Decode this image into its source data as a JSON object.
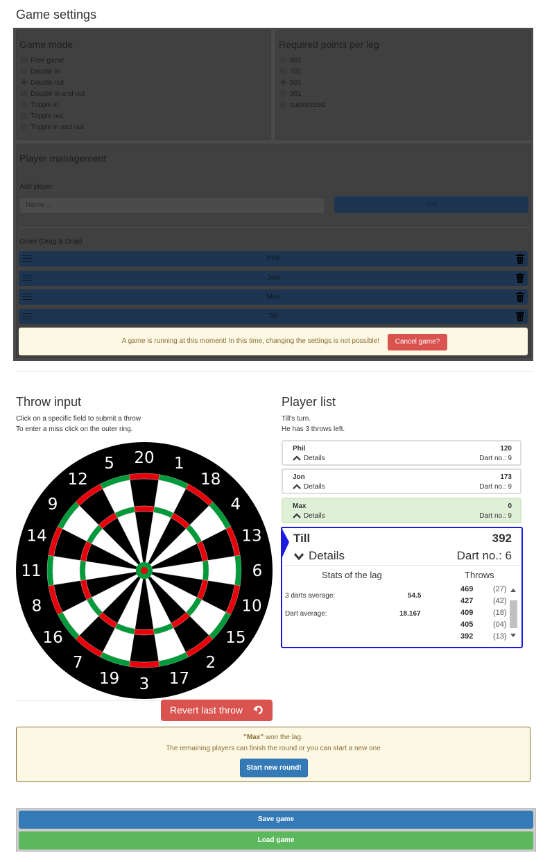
{
  "settings": {
    "title": "Game settings",
    "game_mode": {
      "title": "Game mode",
      "options": [
        "Free game",
        "Double in",
        "Double out",
        "Double in and out",
        "Tripple in",
        "Tripple out",
        "Tripple in and out"
      ],
      "selected_index": 2
    },
    "points": {
      "title": "Required points per leg",
      "options": [
        "901",
        "701",
        "501",
        "301",
        "customized"
      ],
      "selected_index": 2
    },
    "player_management": {
      "title": "Player management",
      "add_label": "Add player",
      "name_placeholder": "Name ...",
      "add_button": "add",
      "order_label": "Order (Drag & Drop)",
      "players": [
        "Phil",
        "Jon",
        "Max",
        "Till"
      ]
    },
    "running_alert": "A game is running at this moment! In this time, changing the settings is not possible!",
    "cancel_button": "Cancel game?"
  },
  "throw_input": {
    "title": "Throw input",
    "hint1": "Click on a specific field to submit a throw",
    "hint2": "To enter a miss click on the outer ring.",
    "board_numbers": [
      "20",
      "1",
      "18",
      "4",
      "13",
      "6",
      "10",
      "15",
      "2",
      "17",
      "3",
      "19",
      "7",
      "16",
      "8",
      "11",
      "14",
      "9",
      "12",
      "5"
    ],
    "revert_button": "Revert last throw"
  },
  "player_list": {
    "title": "Player list",
    "turn_line1": "Till's turn.",
    "turn_line2": "He has 3 throws left.",
    "details_label": "Details",
    "dart_no_prefix": "Dart no.:",
    "players": [
      {
        "name": "Phil",
        "points": "120",
        "dart_no": "Dart no.: 9"
      },
      {
        "name": "Jon",
        "points": "173",
        "dart_no": "Dart no.: 9"
      },
      {
        "name": "Max",
        "points": "0",
        "dart_no": "Dart no.: 9"
      }
    ],
    "active": {
      "name": "Till",
      "points": "392",
      "details": "Details",
      "dart_no": "Dart no.: 6",
      "stats_title": "Stats of the lag",
      "throws_title": "Throws",
      "three_dart_label": "3 darts average:",
      "three_dart_value": "54.5",
      "dart_avg_label": "Dart average:",
      "dart_avg_value": "18.167",
      "throws": [
        {
          "score": "469",
          "hit": "(27)"
        },
        {
          "score": "427",
          "hit": "(42)"
        },
        {
          "score": "409",
          "hit": "(18)"
        },
        {
          "score": "405",
          "hit": "(04)"
        },
        {
          "score": "392",
          "hit": "(13)"
        }
      ]
    }
  },
  "won_alert": {
    "winner": "\"Max\"",
    "won_suffix": " won the lag.",
    "line2": "The remaining players can finish the round or you can start a new one",
    "start_button": "Start new round!"
  },
  "footer": {
    "save_button": "Save game",
    "load_button": "Load game"
  },
  "colors": {
    "primary": "#337ab7",
    "danger": "#d9534f",
    "success": "#5cb85c",
    "warning_bg": "#fcf8e3",
    "active_border": "#1a1ae0",
    "winner_bg": "#dff0d8"
  }
}
